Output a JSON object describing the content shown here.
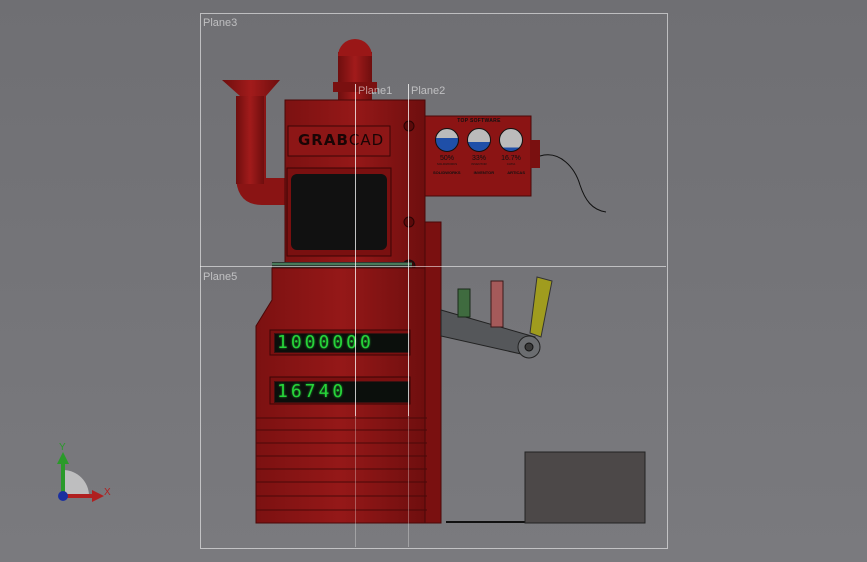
{
  "planes": {
    "plane1": "Plane1",
    "plane2": "Plane2",
    "plane3": "Plane3",
    "plane5": "Plane5"
  },
  "machine": {
    "logo_left": "GRAB",
    "logo_right": "CAD",
    "panel_title": "TOP SOFTWARE",
    "gauges": [
      {
        "value": "50%",
        "sub": "SOLIDWORKS",
        "label": "SOLIDWORKS"
      },
      {
        "value": "33%",
        "sub": "INVENTOR",
        "label": "INVENTOR"
      },
      {
        "value": "16.7%",
        "sub": "CATIA",
        "label": "ARTICAS"
      }
    ],
    "counter_top": "1000000",
    "counter_bottom": "16740"
  },
  "colors": {
    "machine_red": "#8b1414",
    "dark_red": "#5e0c0c",
    "counter_green": "#27d33a",
    "gauge_blue": "#1f4fa8",
    "lever_yellow": "#9e9a1c"
  },
  "triad": {
    "x_label": "X",
    "y_label": "Y"
  }
}
